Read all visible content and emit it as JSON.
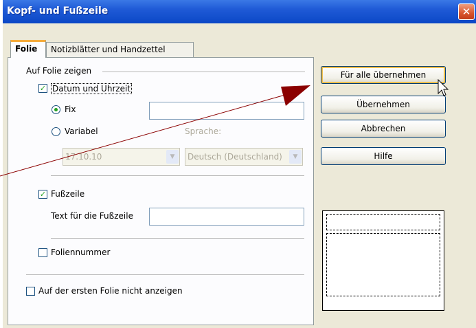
{
  "window": {
    "title": "Kopf- und Fußzeile",
    "close_glyph": "✕"
  },
  "tabs": [
    {
      "label": "Folie",
      "active": true
    },
    {
      "label": "Notizblätter und Handzettel",
      "active": false
    }
  ],
  "group": {
    "title": "Auf Folie zeigen"
  },
  "datetime": {
    "checkbox": {
      "label": "Datum und Uhrzeit",
      "checked": true
    },
    "fix": {
      "label": "Fix",
      "selected": true,
      "value": ""
    },
    "variabel": {
      "label": "Variabel",
      "selected": false
    },
    "format_value": "17.10.10",
    "sprache_label": "Sprache:",
    "sprache_value": "Deutsch (Deutschland)"
  },
  "footer": {
    "checkbox": {
      "label": "Fußzeile",
      "checked": true
    },
    "text_label": "Text für die Fußzeile",
    "text_value": ""
  },
  "slide_number": {
    "label": "Foliennummer",
    "checked": false
  },
  "first_slide": {
    "label": "Auf der ersten Folie nicht anzeigen",
    "checked": false
  },
  "buttons": {
    "apply_all": "Für alle übernehmen",
    "apply": "Übernehmen",
    "cancel": "Abbrechen",
    "help": "Hilfe"
  },
  "colors": {
    "titlebar": "#0b47c6",
    "check": "#21a121",
    "default_highlight": "#f3c14e",
    "annotation_line": "#8b0000"
  }
}
